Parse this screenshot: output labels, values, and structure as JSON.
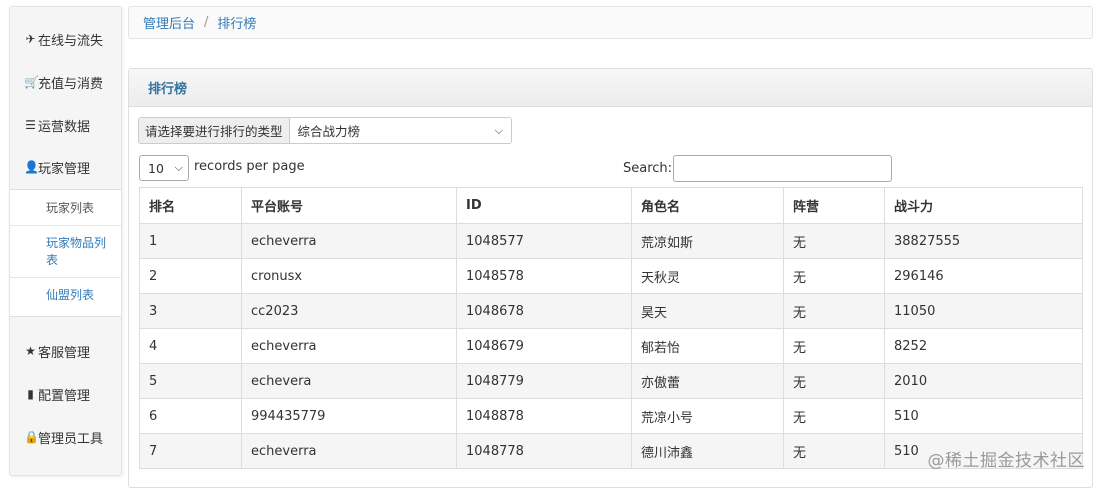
{
  "sidebar": {
    "items": [
      {
        "label": "在线与流失",
        "icon": "plane-icon",
        "glyph": "✈"
      },
      {
        "label": "充值与消费",
        "icon": "cart-icon",
        "glyph": "🛒"
      },
      {
        "label": "运营数据",
        "icon": "list-icon",
        "glyph": "☰"
      },
      {
        "label": "玩家管理",
        "icon": "user-icon",
        "glyph": "👤"
      },
      {
        "label": "客服管理",
        "icon": "star-icon",
        "glyph": "★"
      },
      {
        "label": "配置管理",
        "icon": "book-icon",
        "glyph": "▮"
      },
      {
        "label": "管理员工具",
        "icon": "lock-icon",
        "glyph": "🔒"
      }
    ],
    "sub_items": [
      {
        "label": "玩家列表",
        "active": true
      },
      {
        "label": "玩家物品列表",
        "active": false
      },
      {
        "label": "仙盟列表",
        "active": false
      }
    ]
  },
  "breadcrumb": {
    "home": "管理后台",
    "separator": "/",
    "current": "排行榜"
  },
  "panel": {
    "title": "排行榜",
    "type_label": "请选择要进行排行的类型",
    "type_value": "综合战力榜",
    "page_length": "10",
    "page_length_text": "records per page",
    "search_label": "Search:",
    "search_value": ""
  },
  "table": {
    "columns": [
      "排名",
      "平台账号",
      "ID",
      "角色名",
      "阵营",
      "战斗力"
    ],
    "rows": [
      [
        "1",
        "echeverra",
        "1048577",
        "荒凉如斯",
        "无",
        "38827555"
      ],
      [
        "2",
        "cronusx",
        "1048578",
        "天秋灵",
        "无",
        "296146"
      ],
      [
        "3",
        "cc2023",
        "1048678",
        "昊天",
        "无",
        "11050"
      ],
      [
        "4",
        "echeverra",
        "1048679",
        "郁若怡",
        "无",
        "8252"
      ],
      [
        "5",
        "echevera",
        "1048779",
        "亦傲蕾",
        "无",
        "2010"
      ],
      [
        "6",
        "994435779",
        "1048878",
        "荒凉小号",
        "无",
        "510"
      ],
      [
        "7",
        "echeverra",
        "1048778",
        "德川沛鑫",
        "无",
        "510"
      ]
    ]
  },
  "watermark": "@稀土掘金技术社区",
  "colors": {
    "link": "#337ab7",
    "panel_title": "#33739e"
  }
}
